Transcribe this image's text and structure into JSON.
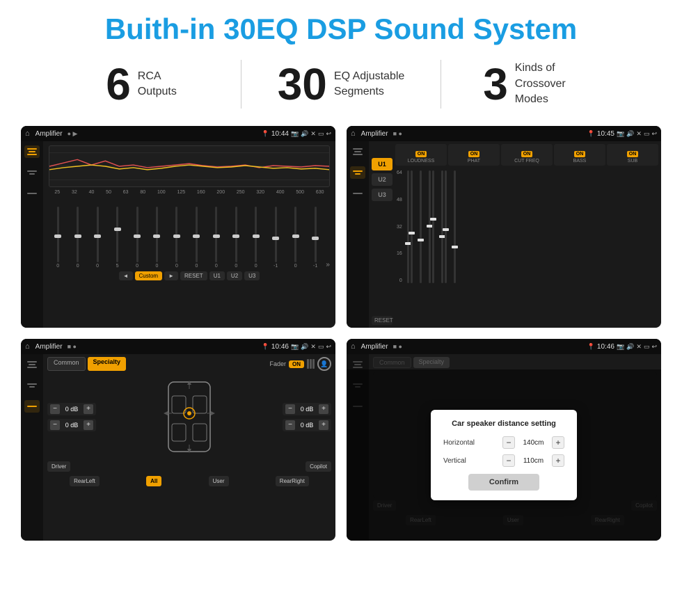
{
  "header": {
    "title": "Buith-in 30EQ DSP Sound System"
  },
  "stats": [
    {
      "number": "6",
      "text": "RCA\nOutputs"
    },
    {
      "number": "30",
      "text": "EQ Adjustable\nSegments"
    },
    {
      "number": "3",
      "text": "Kinds of\nCrossover Modes"
    }
  ],
  "screen1": {
    "title": "Amplifier",
    "time": "10:44",
    "freq_labels": [
      "25",
      "32",
      "40",
      "50",
      "63",
      "80",
      "100",
      "125",
      "160",
      "200",
      "250",
      "320",
      "400",
      "500",
      "630"
    ],
    "eq_values": [
      "0",
      "0",
      "0",
      "5",
      "0",
      "0",
      "0",
      "0",
      "0",
      "0",
      "0",
      "-1",
      "0",
      "-1"
    ],
    "nav_buttons": [
      "Custom",
      "RESET",
      "U1",
      "U2",
      "U3"
    ]
  },
  "screen2": {
    "title": "Amplifier",
    "time": "10:45",
    "u_buttons": [
      "U1",
      "U2",
      "U3"
    ],
    "modules": [
      "LOUDNESS",
      "PHAT",
      "CUT FREQ",
      "BASS",
      "SUB"
    ],
    "reset": "RESET"
  },
  "screen3": {
    "title": "Amplifier",
    "time": "10:46",
    "tabs": [
      "Common",
      "Specialty"
    ],
    "fader_label": "Fader",
    "bottom_buttons": [
      "Driver",
      "Copilot",
      "RearLeft",
      "All",
      "User",
      "RearRight"
    ]
  },
  "screen4": {
    "title": "Amplifier",
    "time": "10:46",
    "tabs": [
      "Common",
      "Specialty"
    ],
    "dialog": {
      "title": "Car speaker distance setting",
      "horizontal_label": "Horizontal",
      "horizontal_value": "140cm",
      "vertical_label": "Vertical",
      "vertical_value": "110cm",
      "confirm_label": "Confirm"
    },
    "bottom_buttons": [
      "Driver",
      "Copilot",
      "RearLeft",
      "User",
      "RearRight"
    ]
  }
}
